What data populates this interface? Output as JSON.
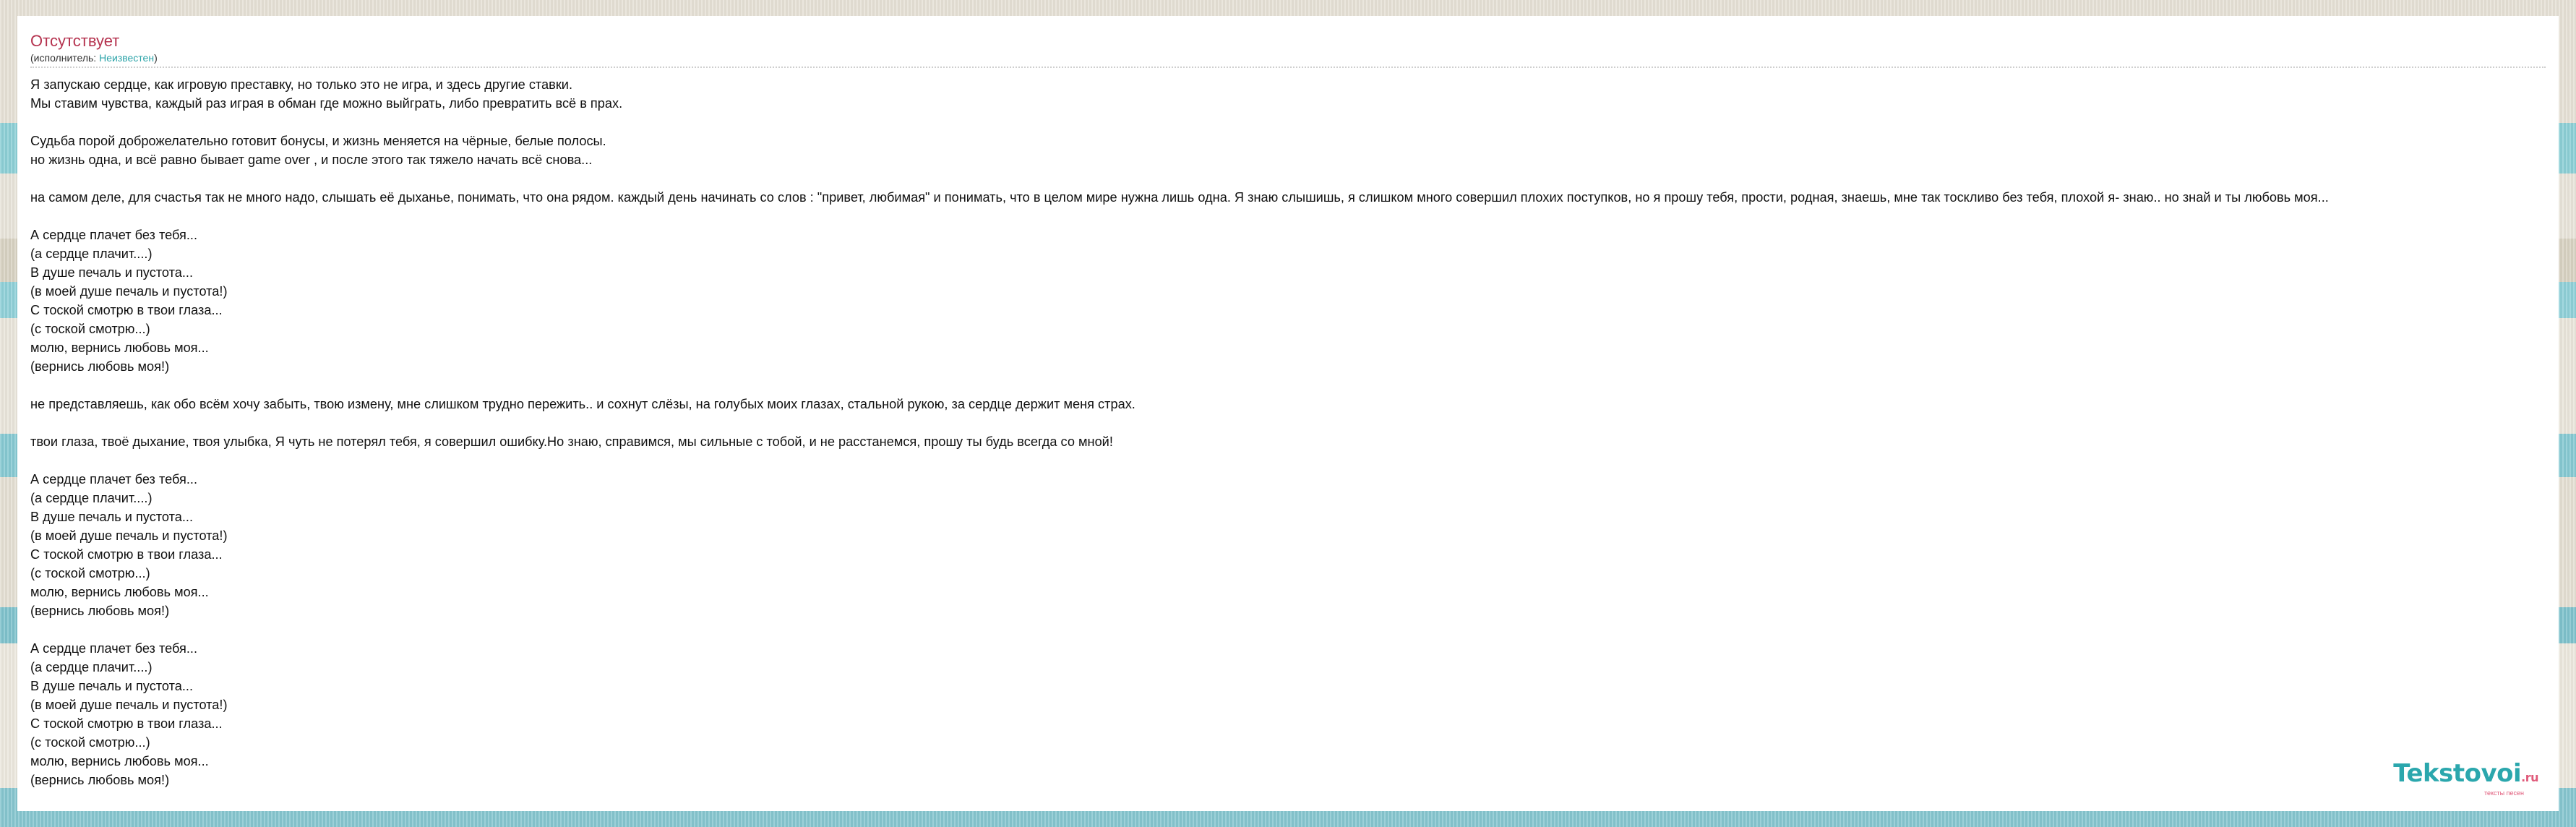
{
  "song": {
    "title": "Отсутствует",
    "artist_prefix": "(исполнитель: ",
    "artist_name": "Неизвестен",
    "artist_suffix": ")"
  },
  "lyrics": [
    [
      "Я запускаю сердце, как игровую преставку, но только это не игра, и здесь другие ставки.",
      "Мы ставим чувства, каждый раз играя в обман где можно выйграть, либо превратить всё в прах."
    ],
    [
      "Судьба порой доброжелательно готовит бонусы, и жизнь меняется на чёрные, белые полосы.",
      "но жизнь одна, и всё равно бывает game over , и после этого так тяжело начать всё снова..."
    ],
    [
      "на самом деле, для счастья так не много надо, слышать её дыханье, понимать, что она рядом. каждый день начинать со слов : \"привет, любимая\" и понимать, что в целом мире нужна лишь одна. Я знаю слышишь, я слишком много совершил плохих поступков, но я прошу тебя, прости, родная, знаешь, мне так тоскливо без тебя, плохой я- знаю.. но знай и ты любовь моя..."
    ],
    [
      "А сердце плачет без тебя...",
      "(а сердце плачит....)",
      "В душе печаль и пустота...",
      "(в моей душе печаль и пустота!)",
      "С тоской смотрю в твои глаза...",
      "(с тоской смотрю...)",
      "молю, вернись любовь моя...",
      "(вернись любовь моя!)"
    ],
    [
      "не представляешь, как обо всём хочу забыть, твою измену, мне слишком трудно пережить.. и сохнут слёзы, на голубых моих глазах, стальной рукою, за сердце держит меня страх."
    ],
    [
      "твои глаза, твоё дыхание, твоя улыбка, Я чуть не потерял тебя, я совершил ошибку.Но знаю, справимся, мы сильные с тобой, и не расстанемся, прошу ты будь всегда со мной!"
    ],
    [
      "А сердце плачет без тебя...",
      "(а сердце плачит....)",
      "В душе печаль и пустота...",
      "(в моей душе печаль и пустота!)",
      "С тоской смотрю в твои глаза...",
      "(с тоской смотрю...)",
      "молю, вернись любовь моя...",
      "(вернись любовь моя!)"
    ],
    [
      "А сердце плачет без тебя...",
      "(а сердце плачит....)",
      "В душе печаль и пустота...",
      "(в моей душе печаль и пустота!)",
      "С тоской смотрю в твои глаза...",
      "(с тоской смотрю...)",
      "молю, вернись любовь моя...",
      "(вернись любовь моя!)"
    ]
  ],
  "logo": {
    "main": "Tekstovoi",
    "ru": ".ru",
    "sub": "тексты песен"
  },
  "colors": {
    "title": "#b5334f",
    "artist_link": "#2aa3a8",
    "logo_main": "#2ba7ad",
    "logo_accent": "#e05a7a"
  }
}
